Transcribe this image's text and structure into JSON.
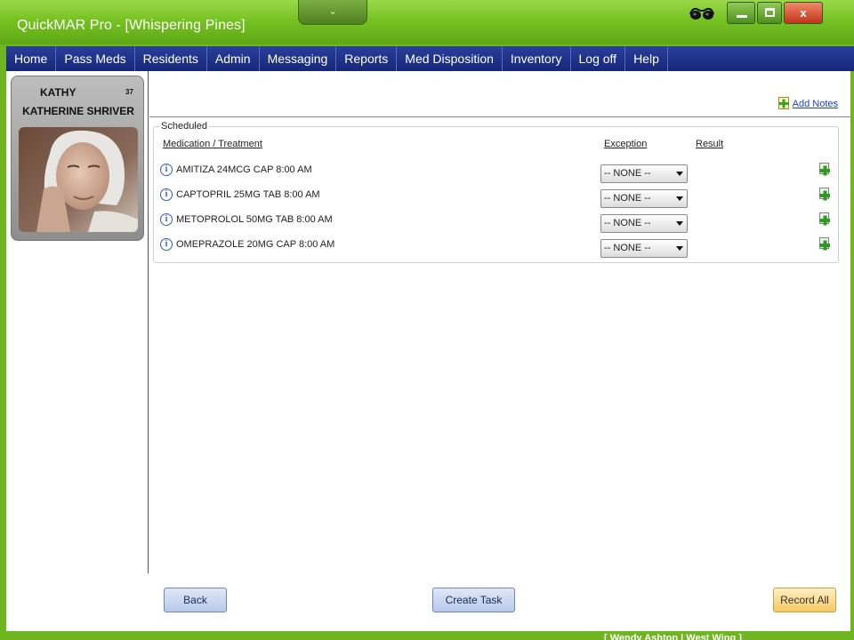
{
  "window": {
    "title": "QuickMAR Pro - [Whispering Pines]",
    "collapse_glyph": "⌄",
    "close_glyph": "x"
  },
  "menu": {
    "items": [
      {
        "label": "Home"
      },
      {
        "label": "Pass Meds"
      },
      {
        "label": "Residents"
      },
      {
        "label": "Admin"
      },
      {
        "label": "Messaging"
      },
      {
        "label": "Reports"
      },
      {
        "label": "Med Disposition"
      },
      {
        "label": "Inventory"
      },
      {
        "label": "Log off"
      },
      {
        "label": "Help"
      }
    ]
  },
  "resident": {
    "first_name": "KATHY",
    "number": "37",
    "full_name": "KATHERINE SHRIVER"
  },
  "notes": {
    "add_label": "Add Notes"
  },
  "scheduled": {
    "legend": "Scheduled",
    "col_medication": "Medication / Treatment",
    "col_exception": "Exception",
    "col_result": "Result",
    "info_glyph": "i",
    "medications": [
      {
        "name": "AMITIZA 24MCG CAP 8:00 AM",
        "exception": "-- NONE --"
      },
      {
        "name": "CAPTOPRIL 25MG TAB 8:00 AM",
        "exception": "-- NONE --"
      },
      {
        "name": "METOPROLOL 50MG TAB 8:00 AM",
        "exception": "-- NONE --"
      },
      {
        "name": "OMEPRAZOLE 20MG CAP 8:00 AM",
        "exception": "-- NONE --"
      }
    ]
  },
  "actions": {
    "back": "Back",
    "create_task": "Create Task",
    "record_all": "Record All"
  },
  "status": {
    "text": "[ Wendy Ashton | West Wing ]"
  },
  "colors": {
    "frame_green": "#6fb51f",
    "menu_blue": "#16267a",
    "link_blue": "#1a3fc8",
    "record_gold": "#f5c860"
  }
}
